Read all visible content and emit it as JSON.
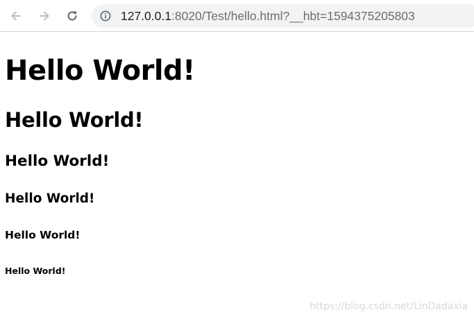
{
  "browser": {
    "url_host": "127.0.0.1",
    "url_rest": ":8020/Test/hello.html?__hbt=1594375205803"
  },
  "page": {
    "headings": [
      "Hello World!",
      "Hello World!",
      "Hello World!",
      "Hello World!",
      "Hello World!",
      "Hello World!"
    ]
  },
  "watermark": "https://blog.csdn.net/LinDadaxia",
  "colors": {
    "toolbar_icon": "#5f6368",
    "omnibox_bg": "#f1f3f4",
    "url_host": "#202124",
    "url_rest": "#6e6e6e",
    "watermark": "#d9d9d9"
  },
  "icons": {
    "back": "arrow-left-icon",
    "forward": "arrow-right-icon",
    "reload": "reload-icon",
    "site_info": "info-icon"
  }
}
